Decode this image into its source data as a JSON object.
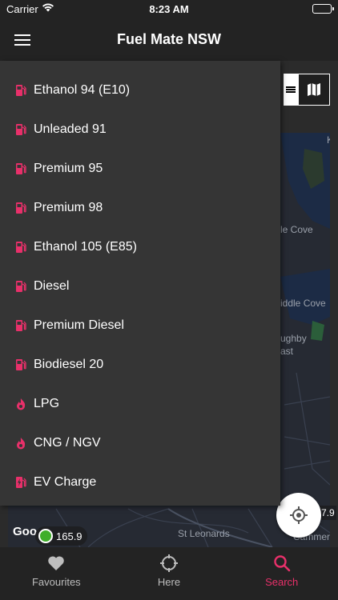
{
  "status_bar": {
    "carrier": "Carrier",
    "time": "8:23 AM"
  },
  "app": {
    "title": "Fuel Mate NSW"
  },
  "accent_color": "#e8306a",
  "drawer": {
    "items": [
      {
        "label": "Ethanol 94 (E10)",
        "icon": "fuel-pump-icon"
      },
      {
        "label": "Unleaded 91",
        "icon": "fuel-pump-icon"
      },
      {
        "label": "Premium 95",
        "icon": "fuel-pump-icon"
      },
      {
        "label": "Premium 98",
        "icon": "fuel-pump-icon"
      },
      {
        "label": "Ethanol 105 (E85)",
        "icon": "fuel-pump-icon"
      },
      {
        "label": "Diesel",
        "icon": "fuel-pump-icon"
      },
      {
        "label": "Premium Diesel",
        "icon": "fuel-pump-icon"
      },
      {
        "label": "Biodiesel 20",
        "icon": "fuel-pump-icon"
      },
      {
        "label": "LPG",
        "icon": "flame-icon"
      },
      {
        "label": "CNG / NGV",
        "icon": "flame-icon"
      },
      {
        "label": "EV Charge",
        "icon": "ev-charge-icon"
      }
    ]
  },
  "map": {
    "labels": {
      "cove_partial": "le Cove",
      "middle_cove_partial": "iddle Cove",
      "suburb_partial_1": "ughby",
      "suburb_partial_2": "ast",
      "top_right_partial": "K",
      "st_leonards": "St Leonards",
      "bottom_right_partial": "Cammera"
    },
    "google": "Google",
    "price_pin": "165.9",
    "edge_price": "7.9"
  },
  "tabs": [
    {
      "label": "Favourites",
      "icon": "heart-icon",
      "active": false
    },
    {
      "label": "Here",
      "icon": "crosshair-icon",
      "active": false
    },
    {
      "label": "Search",
      "icon": "search-icon",
      "active": true
    }
  ]
}
